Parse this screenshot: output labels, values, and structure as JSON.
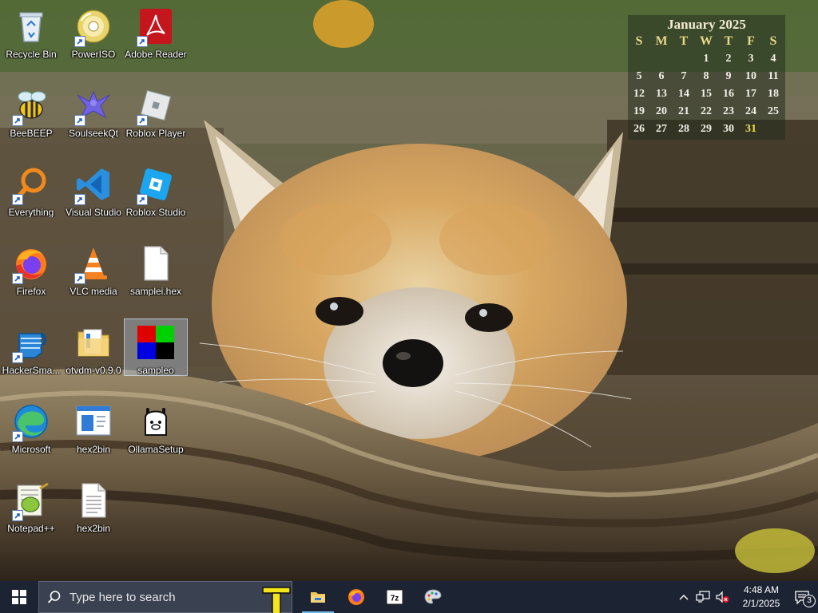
{
  "desktop": {
    "icons": [
      {
        "label": "Recycle Bin",
        "icon": "recycle-bin-icon",
        "shortcut": false
      },
      {
        "label": "PowerISO",
        "icon": "poweriso-disc-icon",
        "shortcut": true
      },
      {
        "label": "Adobe Reader XI",
        "icon": "adobe-reader-icon",
        "shortcut": true
      },
      {
        "label": "BeeBEEP",
        "icon": "beebeep-bee-icon",
        "shortcut": true
      },
      {
        "label": "SoulseekQt",
        "icon": "soulseek-bird-icon",
        "shortcut": true
      },
      {
        "label": "Roblox Player",
        "icon": "roblox-player-icon",
        "shortcut": true
      },
      {
        "label": "Everything",
        "icon": "everything-search-icon",
        "shortcut": true
      },
      {
        "label": "Visual Studio Code",
        "icon": "vscode-icon",
        "shortcut": true
      },
      {
        "label": "Roblox Studio",
        "icon": "roblox-studio-icon",
        "shortcut": true
      },
      {
        "label": "Firefox",
        "icon": "firefox-icon",
        "shortcut": true
      },
      {
        "label": "VLC media player",
        "icon": "vlc-cone-icon",
        "shortcut": true
      },
      {
        "label": "samplei.hex",
        "icon": "blank-file-icon",
        "shortcut": false
      },
      {
        "label": "HackerSma...",
        "icon": "hackersmacker-fist-icon",
        "shortcut": true
      },
      {
        "label": "otvdm-v0.9.0",
        "icon": "folder-icon",
        "shortcut": false
      },
      {
        "label": "sampleo",
        "icon": "rgb-bitmap-icon",
        "shortcut": false
      },
      {
        "label": "Microsoft Edge",
        "icon": "edge-icon",
        "shortcut": true
      },
      {
        "label": "hex2bin",
        "icon": "hex2bin-window-icon",
        "shortcut": false
      },
      {
        "label": "OllamaSetup",
        "icon": "ollama-llama-icon",
        "shortcut": false
      },
      {
        "label": "Notepad++",
        "icon": "notepadpp-icon",
        "shortcut": true
      },
      {
        "label": "hex2bin",
        "icon": "text-file-icon",
        "shortcut": false
      }
    ]
  },
  "calendar": {
    "title": "January 2025",
    "weekdays": [
      "S",
      "M",
      "T",
      "W",
      "T",
      "F",
      "S"
    ],
    "leading_blanks": 3,
    "days": [
      "1",
      "2",
      "3",
      "4",
      "5",
      "6",
      "7",
      "8",
      "9",
      "10",
      "11",
      "12",
      "13",
      "14",
      "15",
      "16",
      "17",
      "18",
      "19",
      "20",
      "21",
      "22",
      "23",
      "24",
      "25",
      "26",
      "27",
      "28",
      "29",
      "30",
      "31"
    ],
    "today": "31",
    "today_color": "#f2e14a"
  },
  "taskbar": {
    "search_placeholder": "Type here to search",
    "apps": [
      {
        "icon": "file-explorer-icon",
        "running": true
      },
      {
        "icon": "firefox-icon",
        "running": false
      },
      {
        "icon": "7zip-icon",
        "running": false
      },
      {
        "icon": "paint-palette-icon",
        "running": false
      }
    ],
    "clock_time": "4:48 AM",
    "clock_date": "2/1/2025",
    "notification_count": "3",
    "accent": "#76b9ed",
    "background": "#1c2433"
  }
}
